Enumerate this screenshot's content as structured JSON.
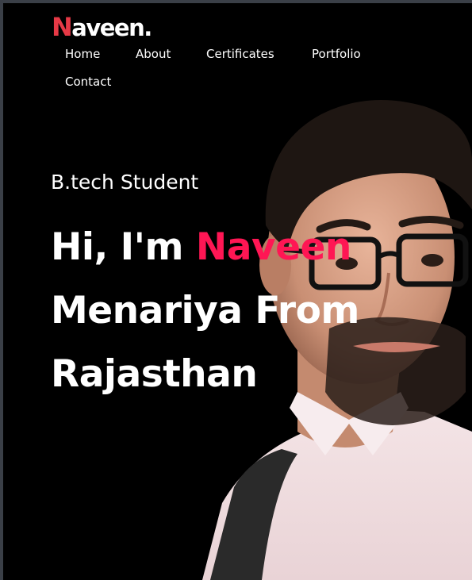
{
  "brand": {
    "logo_first": "N",
    "logo_rest": "aveen.",
    "accent_color": "#ff1654",
    "logo_accent_color": "#e63946"
  },
  "nav": {
    "items": [
      {
        "label": "Home"
      },
      {
        "label": "About"
      },
      {
        "label": "Certificates"
      },
      {
        "label": "Portfolio"
      },
      {
        "label": "Contact"
      }
    ]
  },
  "hero": {
    "subtitle": "B.tech Student",
    "greeting": "Hi, I'm ",
    "name_highlight": "Naveen",
    "line2": "Menariya From",
    "line3": "Rajasthan"
  },
  "colors": {
    "background": "#000000",
    "frame": "#3a3f47",
    "text": "#ffffff"
  }
}
